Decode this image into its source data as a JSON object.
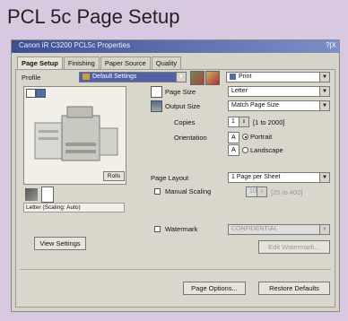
{
  "page_title": "PCL 5c Page Setup",
  "window": {
    "title": "Canon iR C3200 PCL5c Properties",
    "close": "?|X"
  },
  "tabs": [
    {
      "label": "Page Setup"
    },
    {
      "label": "Finishing"
    },
    {
      "label": "Paper Source"
    },
    {
      "label": "Quality"
    }
  ],
  "profile": {
    "label": "Profile",
    "value": "Default Settings"
  },
  "output_method": {
    "value": "Print"
  },
  "page_size": {
    "label": "Page Size",
    "value": "Letter"
  },
  "output_size": {
    "label": "Output Size",
    "value": "Match Page Size"
  },
  "copies": {
    "label": "Copies",
    "value": "1",
    "range": "[1 to 2000]"
  },
  "orientation": {
    "label": "Orientation",
    "portrait": "Portrait",
    "landscape": "Landscape",
    "selected": "Portrait"
  },
  "page_layout": {
    "label": "Page Layout",
    "value": "1 Page per Sheet"
  },
  "manual_scaling": {
    "label": "Manual Scaling",
    "value": "100",
    "range": "[25 to 400]",
    "checked": false
  },
  "preview": {
    "badge": "Rolls",
    "caption": "Letter (Scaling: Auto)"
  },
  "watermark": {
    "label": "Watermark",
    "value": "CONFIDENTIAL",
    "checked": false,
    "edit_button": "Edit Watermark..."
  },
  "buttons": {
    "view_settings": "View Settings",
    "page_options": "Page Options...",
    "restore_defaults": "Restore Defaults"
  },
  "colors": {
    "frame": "#d9c9e0",
    "dialog": "#d6d3c9",
    "titlebar": "#3d4f91",
    "accent": "#5260a8"
  }
}
